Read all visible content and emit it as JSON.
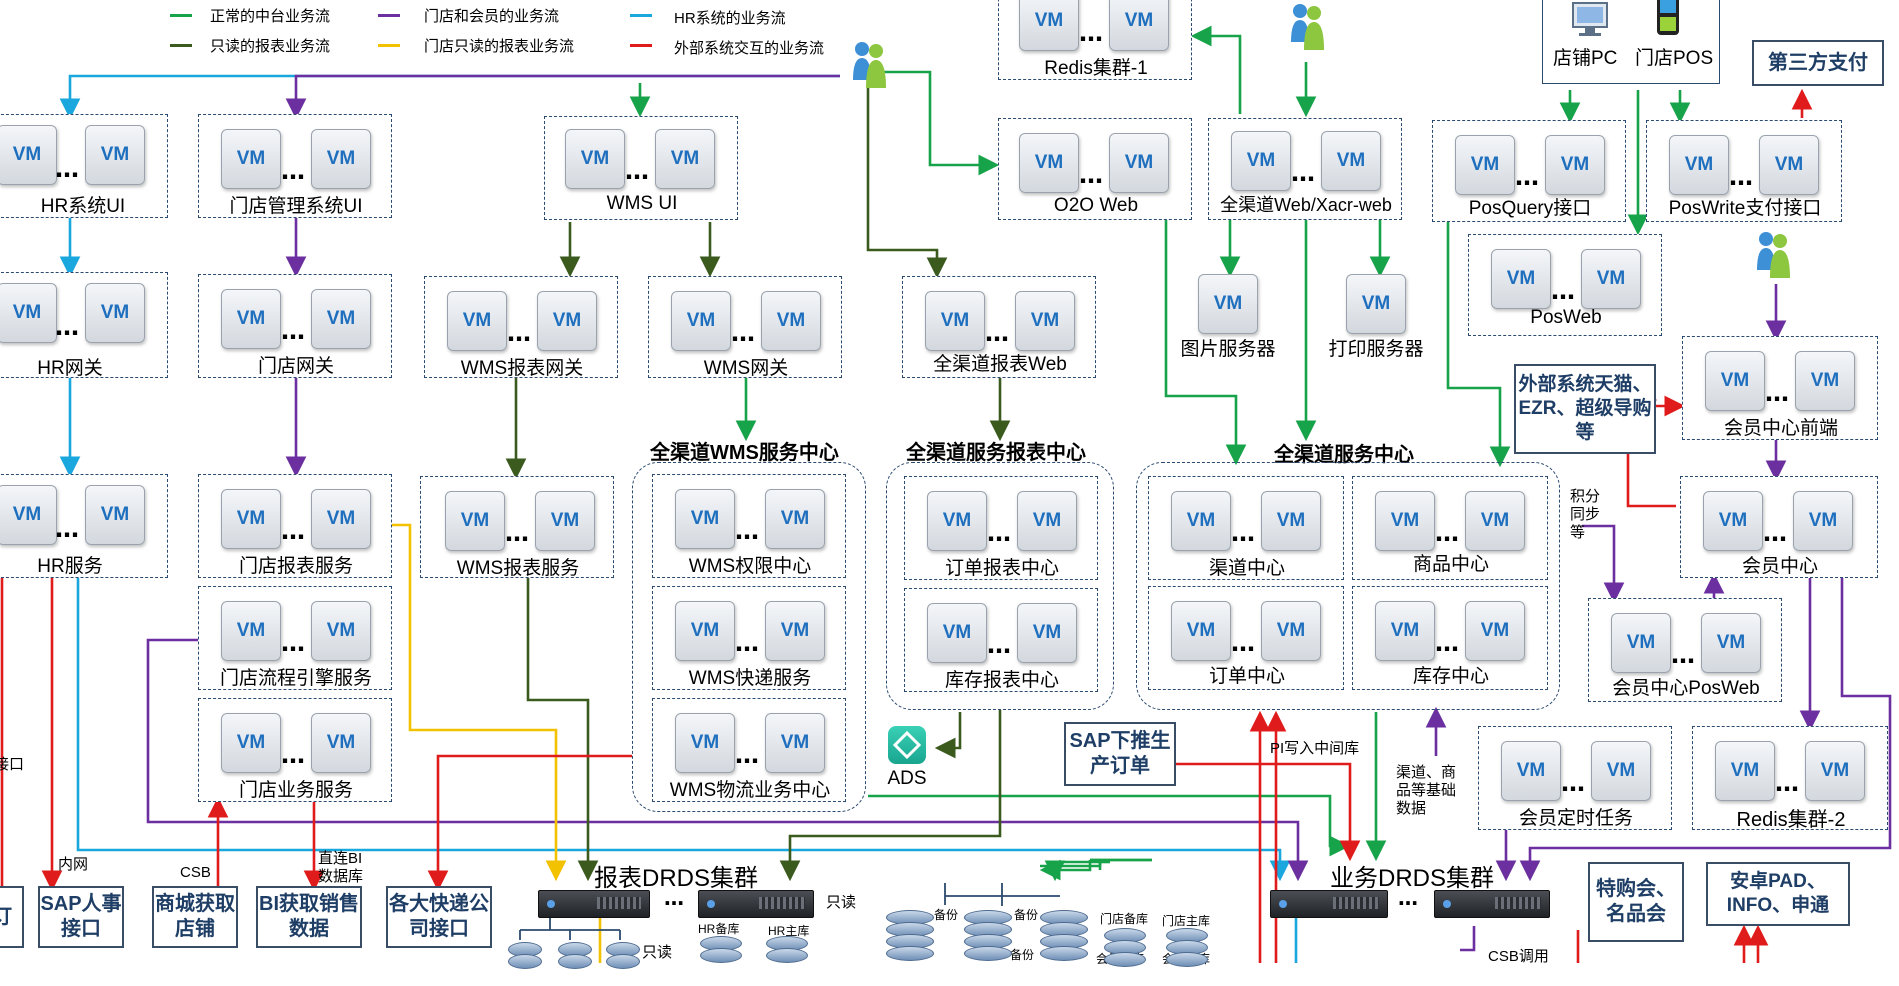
{
  "legend": [
    {
      "label": "正常的中台业务流",
      "color": "#17a34a"
    },
    {
      "label": "门店和会员的业务流",
      "color": "#6b2fa0"
    },
    {
      "label": "HR系统的业务流",
      "color": "#1aa7dd"
    },
    {
      "label": "只读的报表业务流",
      "color": "#3a5a1e"
    },
    {
      "label": "门店只读的报表业务流",
      "color": "#f2c200"
    },
    {
      "label": "外部系统交互的业务流",
      "color": "#e01b1b"
    }
  ],
  "vm_text": "VM",
  "dots": "…",
  "clusters": {
    "hr_ui": "HR系统UI",
    "hr_gateway": "HR网关",
    "hr_service": "HR服务",
    "store_mgmt_ui": "门店管理系统UI",
    "store_gateway": "门店网关",
    "store_report": "门店报表服务",
    "store_flow": "门店流程引擎服务",
    "store_biz": "门店业务服务",
    "wms_ui": "WMS UI",
    "wms_report_gateway": "WMS报表网关",
    "wms_gateway": "WMS网关",
    "wms_report_service": "WMS报表服务",
    "wms_auth": "WMS权限中心",
    "wms_express": "WMS快递服务",
    "wms_logistics": "WMS物流业务中心",
    "omni_report_web": "全渠道报表Web",
    "order_report": "订单报表中心",
    "stock_report": "库存报表中心",
    "redis1": "Redis集群-1",
    "o2o_web": "O2O Web",
    "omni_web": "全渠道Web/Xacr-web",
    "image_server": "图片服务器",
    "print_server": "打印服务器",
    "channel_center": "渠道中心",
    "product_center": "商品中心",
    "order_center": "订单中心",
    "stock_center": "库存中心",
    "pos_query": "PosQuery接口",
    "pos_write": "PosWrite支付接口",
    "pos_web": "PosWeb",
    "member_front": "会员中心前端",
    "member_center": "会员中心",
    "member_posweb": "会员中心PosWeb",
    "member_timer": "会员定时任务",
    "redis2": "Redis集群-2"
  },
  "groups": {
    "wms_center": "全渠道WMS服务中心",
    "report_center": "全渠道服务报表中心",
    "service_center": "全渠道服务中心"
  },
  "devices": {
    "store_pc": "店铺PC",
    "store_pos": "门店POS"
  },
  "solid_boxes": {
    "third_pay": "第三方支付",
    "external_sys": "外部系统天猫、EZR、超级导购等",
    "sap_order": "SAP下推生产订单",
    "sap_hr": "SAP人事接口",
    "mall_store": "商城获取店铺",
    "bi_sales": "BI获取销售数据",
    "express_api": "各大快递公司接口",
    "special_buy": "特购会、名品会",
    "android_pad": "安卓PAD、INFO、申通",
    "left_cut": "订"
  },
  "drds": {
    "report": "报表DRDS集群",
    "biz": "业务DRDS集群"
  },
  "ads": "ADS",
  "notes": {
    "points_sync": "积分同步等",
    "pi_write": "PI写入中间库",
    "channel_data": "渠道、商品等基础数据",
    "readonly1": "只读",
    "readonly2": "只读",
    "csb": "CSB",
    "intranet": "内网",
    "direct_bi": "直连BI数据库",
    "csb_call": "CSB调用",
    "left_api": "接口",
    "hr_backup": "HR备库",
    "hr_main": "HR主库",
    "backup1": "备份",
    "backup2": "备份",
    "backup3": "备份",
    "store_backup": "门店备库",
    "store_main": "门店主库",
    "member_main": "会员主库",
    "member_backup": "会员备库"
  }
}
